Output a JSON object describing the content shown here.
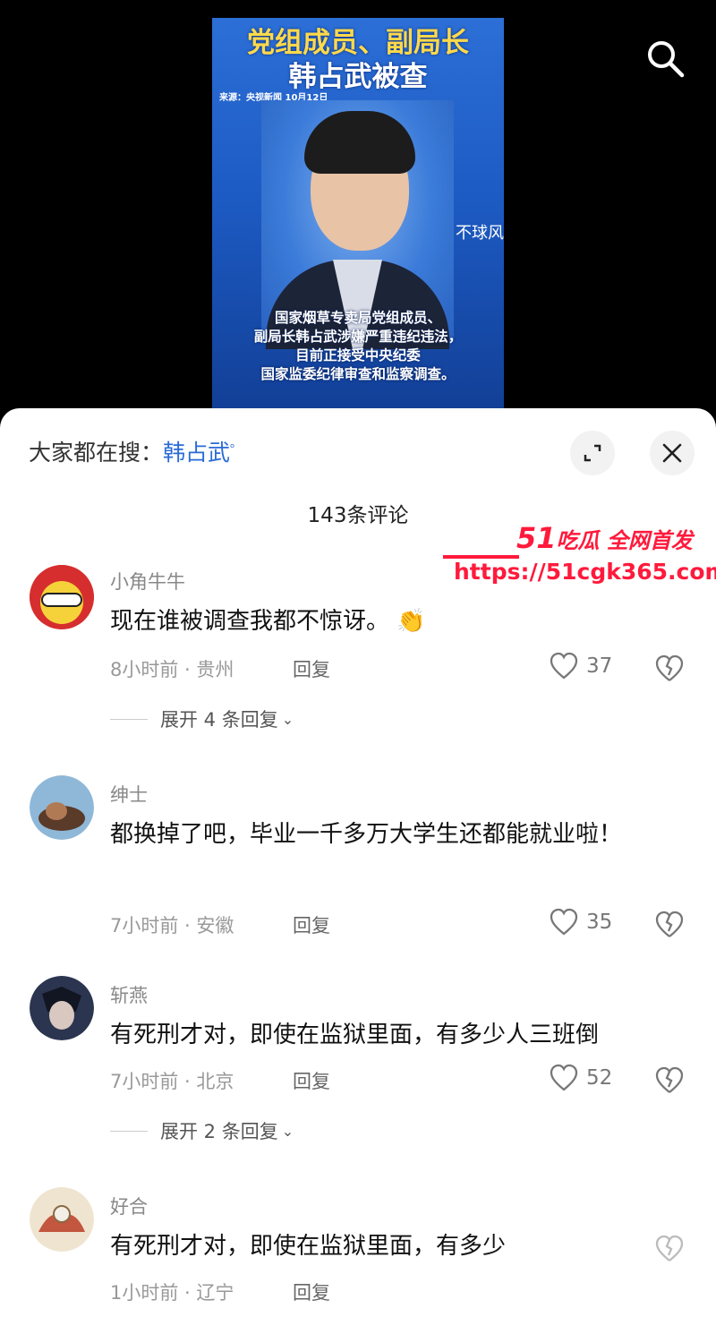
{
  "video": {
    "headline_line1": "党组成员、副局长",
    "headline_line2": "韩占武被查",
    "source": "来源：央视新闻 10月12日",
    "watermark": "不球风",
    "caption": [
      "国家烟草专卖局党组成员、",
      "副局长韩占武涉嫌严重违纪违法，",
      "目前正接受中央纪委",
      "国家监委纪律审查和监察调查。"
    ]
  },
  "search_icon": "search-icon",
  "sheet": {
    "search_prefix": "大家都在搜：",
    "search_keyword": "韩占武",
    "comment_count": "143条评论"
  },
  "promo": {
    "number": "51",
    "tagline": "吃瓜 全网首发",
    "url": "https://51cgk365.com"
  },
  "comments": [
    {
      "user": "小角牛牛",
      "text": "现在谁被调查我都不惊讶。",
      "emoji": "👏",
      "time_loc": "8小时前 · 贵州",
      "reply": "回复",
      "likes": "37",
      "replies_label": "展开 4 条回复"
    },
    {
      "user": "绅士",
      "text": "都换掉了吧，毕业一千多万大学生还都能就业啦！",
      "time_loc": "7小时前 · 安徽",
      "reply": "回复",
      "likes": "35"
    },
    {
      "user": "斩燕",
      "text": "有死刑才对，即使在监狱里面，有多少人三班倒",
      "time_loc": "7小时前 · 北京",
      "reply": "回复",
      "likes": "52",
      "replies_label": "展开 2 条回复"
    },
    {
      "user": "好合",
      "text": "有死刑才对，即使在监狱里面，有多少",
      "time_loc": "1小时前 · 辽宁",
      "reply": "回复"
    }
  ],
  "colors": {
    "accent": "#2a6bd6",
    "promo_red": "#ff1a3c"
  }
}
